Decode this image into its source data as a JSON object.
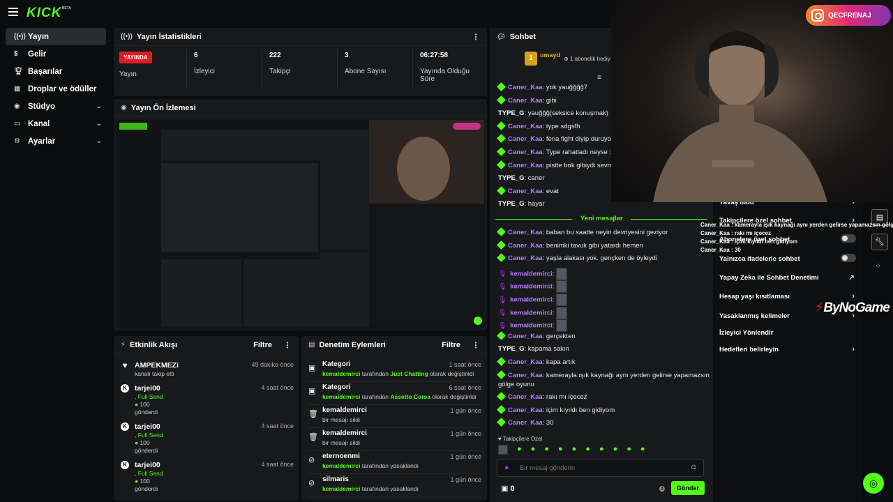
{
  "brand": {
    "logo": "KICK",
    "beta": "BETA",
    "accent": "#53fc18"
  },
  "sidebar": {
    "items": [
      {
        "label": "Yayın",
        "icon": "broadcast-icon",
        "active": true
      },
      {
        "label": "Gelir",
        "icon": "money-icon"
      },
      {
        "label": "Başarılar",
        "icon": "trophy-icon"
      },
      {
        "label": "Droplar ve ödüller",
        "icon": "gift-icon"
      },
      {
        "label": "Stüdyo",
        "icon": "studio-icon",
        "expandable": true
      },
      {
        "label": "Kanal",
        "icon": "channel-icon",
        "expandable": true
      },
      {
        "label": "Ayarlar",
        "icon": "gear-icon",
        "expandable": true
      }
    ]
  },
  "stats": {
    "title": "Yayın İstatistikleri",
    "live_badge": "YAYINDA",
    "live_label": "Yayın",
    "viewers": {
      "value": "6",
      "label": "İzleyici"
    },
    "followers": {
      "value": "222",
      "label": "Takipçi"
    },
    "subs": {
      "value": "3",
      "label": "Abone Sayısı"
    },
    "uptime": {
      "value": "06:27:58",
      "label": "Yayında Olduğu Süre"
    }
  },
  "preview": {
    "title": "Yayın Ön İzlemesi"
  },
  "activity": {
    "title": "Etkinlik Akışı",
    "filter": "Filtre",
    "items": [
      {
        "name": "AMPEKMEZi",
        "time": "49 dakika önce",
        "line1": "kanalı takip etti",
        "line2": "",
        "line3": ""
      },
      {
        "name": "tarjei00",
        "time": "4 saat önce",
        "line1": ", Full Send",
        "line2": "100",
        "line3": "gönderdi"
      },
      {
        "name": "tarjei00",
        "time": "4 saat önce",
        "line1": ", Full Send",
        "line2": "100",
        "line3": "gönderdi"
      },
      {
        "name": "tarjei00",
        "time": "4 saat önce",
        "line1": ", Full Send",
        "line2": "100",
        "line3": "gönderdi"
      }
    ]
  },
  "moderation": {
    "title": "Denetim Eylemleri",
    "filter": "Filtre",
    "items": [
      {
        "name": "Kategori",
        "time": "1 saat önce",
        "actor": "kemaldemirci",
        "mid": "tarafından",
        "target": "Just Chatting",
        "rest": "olarak değiştirildi",
        "icon": "category-icon"
      },
      {
        "name": "Kategori",
        "time": "6 saat önce",
        "actor": "kemaldemirci",
        "mid": "tarafından",
        "target": "Assetto Corsa",
        "rest": "olarak değiştirildi",
        "icon": "category-icon"
      },
      {
        "name": "kemaldemirci",
        "time": "1 gün önce",
        "actor": "",
        "mid": "",
        "target": "",
        "rest": "bir mesajı sildi",
        "icon": "trash-icon"
      },
      {
        "name": "kemaldemirci",
        "time": "1 gün önce",
        "actor": "",
        "mid": "",
        "target": "",
        "rest": "bir mesajı sildi",
        "icon": "trash-icon"
      },
      {
        "name": "eternoenmi",
        "time": "1 gün önce",
        "actor": "kemaldemirci",
        "mid": "tarafından yasaklandı",
        "target": "",
        "rest": "",
        "icon": "ban-icon"
      },
      {
        "name": "silmaris",
        "time": "1 gün önce",
        "actor": "kemaldemirci",
        "mid": "tarafından yasaklandı",
        "target": "",
        "rest": "",
        "icon": "ban-icon"
      }
    ]
  },
  "chat": {
    "title": "Sohbet",
    "pinned_user": "umayd",
    "pinned_count": "1",
    "pinned_text": "1 abonelik hediy",
    "new_messages": "Yeni mesajlar",
    "messages_before": [
      {
        "user": "Caner_Kaa",
        "text": ": yok yauğğğğ7",
        "kind": "green"
      },
      {
        "user": "Caner_Kaa",
        "text": ": gibi",
        "kind": "green"
      },
      {
        "user": "TYPE_G",
        "text": ": yauğğğ(seksice konuşmak)",
        "kind": "plain"
      },
      {
        "user": "Caner_Kaa",
        "text": ": type sdgsfh",
        "kind": "green"
      },
      {
        "user": "Caner_Kaa",
        "text": ": fena fight diyip duruyon 8",
        "kind": "green"
      },
      {
        "user": "Caner_Kaa",
        "text": ": Type rahatladı neyse :D",
        "kind": "green"
      },
      {
        "user": "Caner_Kaa",
        "text": ": pistte bok gibiydi sevmedi",
        "kind": "green"
      },
      {
        "user": "TYPE_G",
        "text": ": caner",
        "kind": "plain"
      },
      {
        "user": "Caner_Kaa",
        "text": ": evat",
        "kind": "green"
      },
      {
        "user": "TYPE_G",
        "text": ": hayar",
        "kind": "plain"
      }
    ],
    "messages_after": [
      {
        "user": "Caner_Kaa",
        "text": ": baban bu saatte neyin devriyesini geziyor",
        "kind": "green"
      },
      {
        "user": "Caner_Kaa",
        "text": ": benimki tavuk gibi yatardı hemen",
        "kind": "green"
      },
      {
        "user": "Caner_Kaa",
        "text": ": yaşla alakası yok. gençken de öyleydi",
        "kind": "green"
      },
      {
        "user": "kemaldemirci",
        "text": ":",
        "kind": "mod"
      },
      {
        "user": "kemaldemirci",
        "text": ":",
        "kind": "mod"
      },
      {
        "user": "kemaldemirci",
        "text": ":",
        "kind": "mod"
      },
      {
        "user": "kemaldemirci",
        "text": ":",
        "kind": "mod"
      },
      {
        "user": "kemaldemirci",
        "text": ":",
        "kind": "mod"
      },
      {
        "user": "Caner_Kaa",
        "text": ": gerçekten",
        "kind": "green"
      },
      {
        "user": "TYPE_G",
        "text": ": kapama sakın",
        "kind": "plain"
      },
      {
        "user": "Caner_Kaa",
        "text": ": kapa artık",
        "kind": "green"
      },
      {
        "user": "Caner_Kaa",
        "text": ": kamerayla ışık kaynağı aynı yerden gelirse yapamazsın",
        "kind": "green"
      },
      {
        "user": "",
        "text": "gölge oyunu",
        "kind": "cont"
      },
      {
        "user": "Caner_Kaa",
        "text": ": rakı mı içecez",
        "kind": "green"
      },
      {
        "user": "Caner_Kaa",
        "text": ": içim kıyıldı ben gidiyom",
        "kind": "green"
      },
      {
        "user": "Caner_Kaa",
        "text": ": 30",
        "kind": "green"
      }
    ],
    "followers_only": "Takipçilere Özel",
    "input_placeholder": "Bir mesaj gönderin",
    "points": "0",
    "send_label": "Gönder"
  },
  "settings": {
    "items": [
      {
        "label": "Yavaş mod",
        "control": "chevron"
      },
      {
        "label": "Takipçilere özel sohbet",
        "control": "chevron"
      },
      {
        "label": "Abonelere özel sohbet",
        "control": "toggle"
      },
      {
        "label": "Yalnızca ifadelerle sohbet",
        "control": "toggle"
      },
      {
        "label": "Yapay Zeka ile Sohbet Denetimi",
        "control": "external"
      },
      {
        "label": "Hesap yaşı kısıtlaması",
        "control": "chevron"
      },
      {
        "label": "Yasaklanmış kelimeler",
        "control": "chevron"
      },
      {
        "label": "İzleyici Yönlendir",
        "control": "none"
      },
      {
        "label": "Hedefleri belirleyin",
        "control": "chevron"
      }
    ]
  },
  "overlay": {
    "instagram": "QECFRENAJ",
    "sponsor_left": "By",
    "sponsor_right": "NoGame",
    "chat": [
      "Caner_Kaa : kamerayla ışık kaynağı aynı yerden gelirse yapamazsın gölge oyunu",
      "Caner_Kaa : rakı mı içecez",
      "Caner_Kaa : içim kıyıldı ben gidiyom",
      "Caner_Kaa : 30"
    ]
  }
}
